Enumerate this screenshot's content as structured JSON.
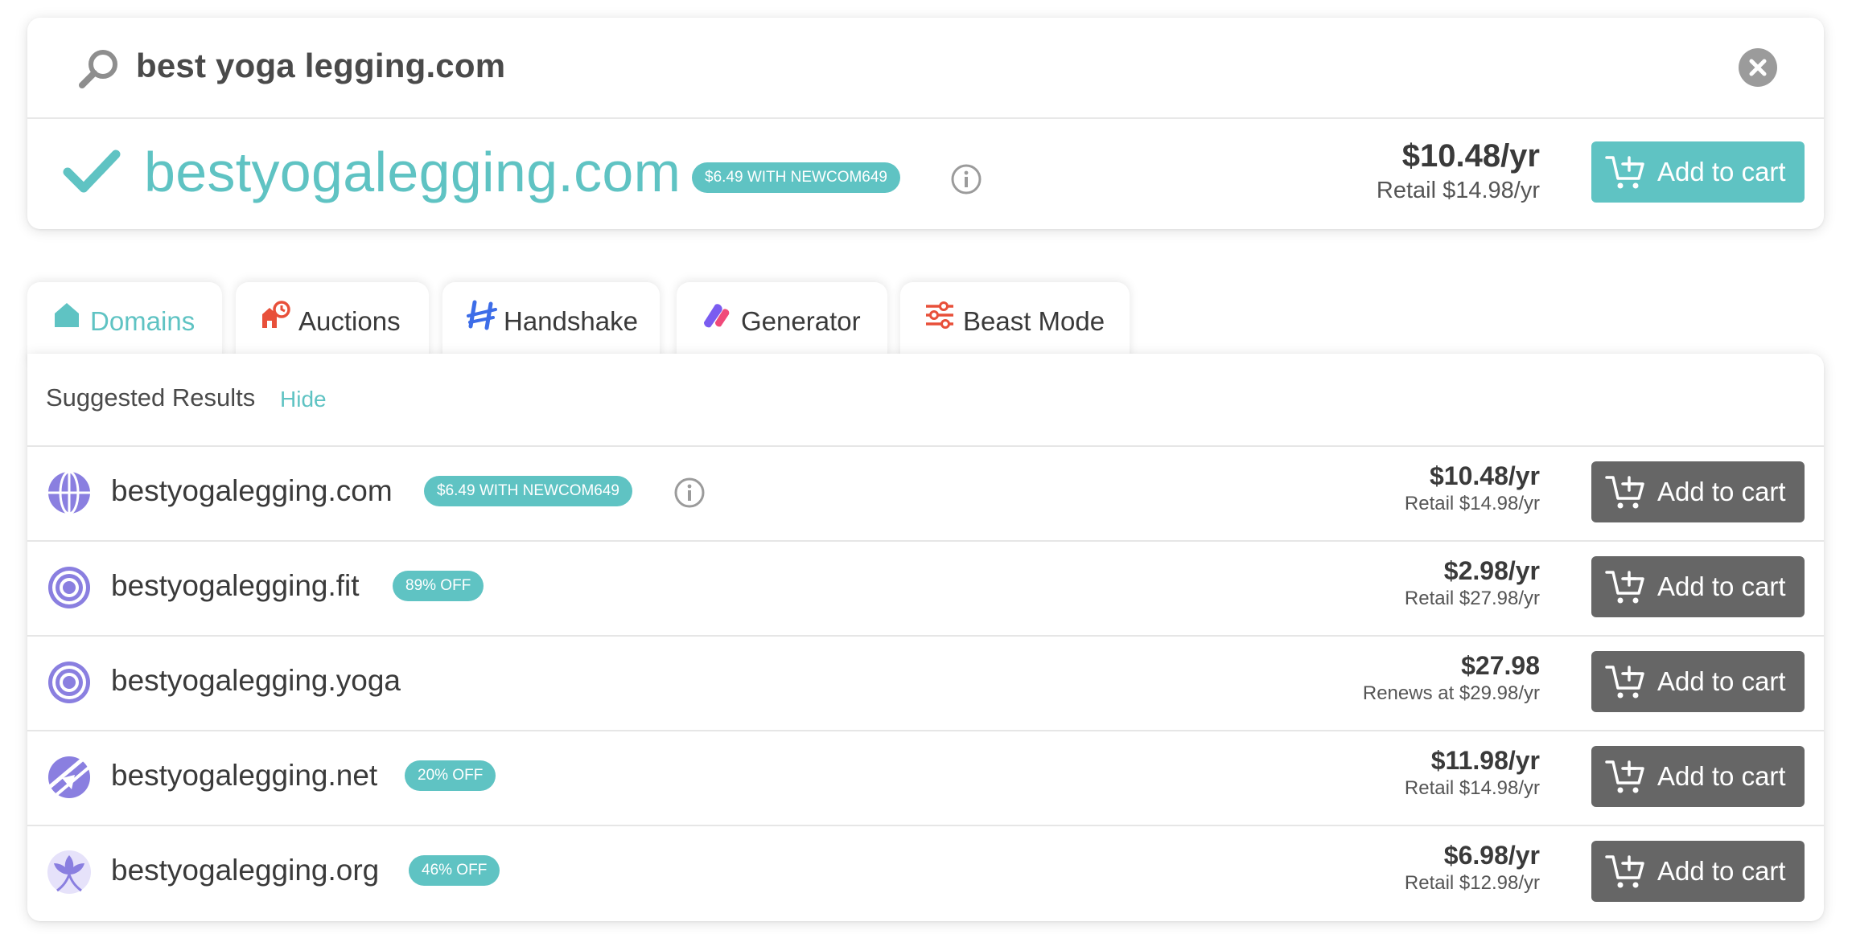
{
  "search": {
    "query": "best yoga legging.com",
    "clear_icon": "close-icon"
  },
  "hero": {
    "domain": "bestyogalegging.com",
    "promo": "$6.49 WITH NEWCOM649",
    "price": "$10.48/yr",
    "retail": "Retail $14.98/yr",
    "cart_label": "Add to cart"
  },
  "tabs": [
    {
      "label": "Domains",
      "icon": "home-icon",
      "active": true
    },
    {
      "label": "Auctions",
      "icon": "auction-icon",
      "active": false
    },
    {
      "label": "Handshake",
      "icon": "handshake-icon",
      "active": false
    },
    {
      "label": "Generator",
      "icon": "generator-icon",
      "active": false
    },
    {
      "label": "Beast Mode",
      "icon": "sliders-icon",
      "active": false
    }
  ],
  "results": {
    "title": "Suggested Results",
    "hide_label": "Hide",
    "rows": [
      {
        "domain": "bestyogalegging.com",
        "promo": "$6.49 WITH NEWCOM649",
        "has_info": true,
        "price": "$10.48/yr",
        "retail": "Retail $14.98/yr",
        "cart_label": "Add to cart",
        "icon": "globe-icon"
      },
      {
        "domain": "bestyogalegging.fit",
        "promo": "89% OFF",
        "has_info": false,
        "price": "$2.98/yr",
        "retail": "Retail $27.98/yr",
        "cart_label": "Add to cart",
        "icon": "target-icon"
      },
      {
        "domain": "bestyogalegging.yoga",
        "promo": "",
        "has_info": false,
        "price": "$27.98",
        "retail": "Renews at $29.98/yr",
        "cart_label": "Add to cart",
        "icon": "target-icon"
      },
      {
        "domain": "bestyogalegging.net",
        "promo": "20% OFF",
        "has_info": false,
        "price": "$11.98/yr",
        "retail": "Retail $14.98/yr",
        "cart_label": "Add to cart",
        "icon": "net-planet-icon"
      },
      {
        "domain": "bestyogalegging.org",
        "promo": "46% OFF",
        "has_info": false,
        "price": "$6.98/yr",
        "retail": "Retail $12.98/yr",
        "cart_label": "Add to cart",
        "icon": "lotus-icon"
      }
    ]
  },
  "colors": {
    "accent": "#5fc3c3",
    "cart_dark": "#666666",
    "tld_purple": "#8a7fe0"
  }
}
